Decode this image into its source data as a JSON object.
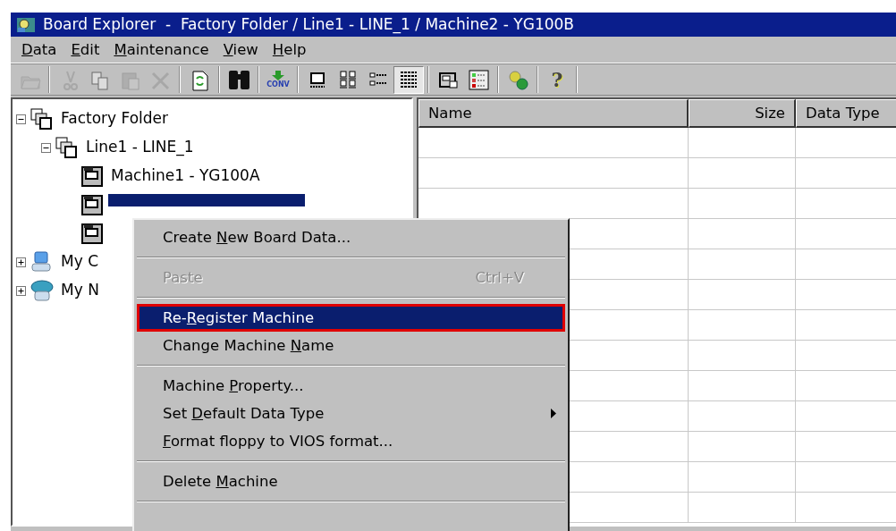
{
  "window": {
    "title": "Board Explorer  -  Factory Folder / Line1 - LINE_1 / Machine2 - YG100B"
  },
  "menu_bar": [
    {
      "accel": "D",
      "after": "ata"
    },
    {
      "accel": "E",
      "after": "dit"
    },
    {
      "accel": "M",
      "after": "aintenance"
    },
    {
      "accel": "V",
      "after": "iew"
    },
    {
      "accel": "H",
      "after": "elp"
    }
  ],
  "toolbar": [
    {
      "kind": "open",
      "disabled": true,
      "pressed": false
    },
    {
      "kind": "sep"
    },
    {
      "kind": "cut",
      "disabled": true,
      "pressed": false
    },
    {
      "kind": "copy",
      "disabled": true,
      "pressed": false
    },
    {
      "kind": "paste",
      "disabled": true,
      "pressed": false
    },
    {
      "kind": "delete",
      "disabled": true,
      "pressed": false
    },
    {
      "kind": "sep"
    },
    {
      "kind": "refresh",
      "disabled": false,
      "pressed": false
    },
    {
      "kind": "sep"
    },
    {
      "kind": "find",
      "disabled": false,
      "pressed": false
    },
    {
      "kind": "sep"
    },
    {
      "kind": "conv",
      "label": "CONV",
      "disabled": false,
      "pressed": false
    },
    {
      "kind": "sep"
    },
    {
      "kind": "large",
      "disabled": false,
      "pressed": false
    },
    {
      "kind": "small",
      "disabled": false,
      "pressed": false
    },
    {
      "kind": "list",
      "disabled": false,
      "pressed": false
    },
    {
      "kind": "details",
      "disabled": false,
      "pressed": true
    },
    {
      "kind": "sep"
    },
    {
      "kind": "machine",
      "disabled": false,
      "pressed": false
    },
    {
      "kind": "legend",
      "disabled": false,
      "pressed": false
    },
    {
      "kind": "sep"
    },
    {
      "kind": "gears",
      "disabled": false,
      "pressed": false
    },
    {
      "kind": "sep"
    },
    {
      "kind": "help",
      "label": "?",
      "disabled": false,
      "pressed": false
    },
    {
      "kind": "sep"
    }
  ],
  "tree": [
    {
      "kind": "folder",
      "label": "Factory Folder",
      "expanded": true,
      "selected": false,
      "children": [
        {
          "kind": "folder",
          "label": "Line1 - LINE_1",
          "expanded": true,
          "selected": false,
          "children": [
            {
              "kind": "machine",
              "label": "Machine1 - YG100A",
              "selected": false
            },
            {
              "kind": "machine",
              "selected": true
            },
            {
              "kind": "machine",
              "selected": false
            }
          ]
        }
      ]
    },
    {
      "kind": "computer",
      "label": "My C",
      "expanded": false,
      "selected": false
    },
    {
      "kind": "network",
      "label": "My N",
      "expanded": false,
      "selected": false
    }
  ],
  "list": {
    "columns": [
      {
        "label": "Name"
      },
      {
        "label": "Size"
      },
      {
        "label": "Data Type"
      }
    ]
  },
  "context_menu": {
    "items": [
      {
        "kind": "item",
        "before": "Create ",
        "accel": "N",
        "after": "ew Board Data...",
        "disabled": false,
        "selected": false,
        "submenu": false
      },
      {
        "kind": "separator"
      },
      {
        "kind": "item",
        "after": "Paste",
        "shortcut": "Ctrl+V",
        "disabled": true,
        "selected": false,
        "submenu": false
      },
      {
        "kind": "separator"
      },
      {
        "kind": "item",
        "before": "Re-",
        "accel": "R",
        "after": "egister Machine",
        "disabled": false,
        "selected": true,
        "outlined": true,
        "submenu": false
      },
      {
        "kind": "item",
        "before": "Change Machine ",
        "accel": "N",
        "after": "ame",
        "disabled": false,
        "selected": false,
        "submenu": false
      },
      {
        "kind": "separator"
      },
      {
        "kind": "item",
        "before": "Machine ",
        "accel": "P",
        "after": "roperty...",
        "disabled": false,
        "selected": false,
        "submenu": false
      },
      {
        "kind": "item",
        "before": "Set ",
        "accel": "D",
        "after": "efault Data Type",
        "disabled": false,
        "selected": false,
        "submenu": true
      },
      {
        "kind": "item",
        "accel": "F",
        "after": "ormat floppy to VIOS format...",
        "disabled": false,
        "selected": false,
        "submenu": false
      },
      {
        "kind": "separator"
      },
      {
        "kind": "item",
        "before": "Delete ",
        "accel": "M",
        "after": "achine",
        "disabled": false,
        "selected": false,
        "submenu": false
      },
      {
        "kind": "separator"
      }
    ]
  }
}
